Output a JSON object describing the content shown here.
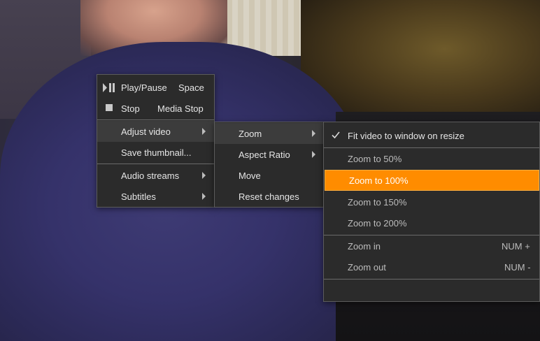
{
  "main_menu": {
    "items": [
      {
        "label": "Play/Pause",
        "shortcut": "Space",
        "icon": "play-pause-icon"
      },
      {
        "label": "Stop",
        "shortcut": "Media Stop",
        "icon": "stop-icon"
      },
      {
        "label": "Adjust video",
        "submenu": true
      },
      {
        "label": "Save thumbnail..."
      },
      {
        "label": "Audio streams",
        "submenu": true
      },
      {
        "label": "Subtitles",
        "submenu": true
      }
    ]
  },
  "adjust_menu": {
    "items": [
      {
        "label": "Zoom",
        "submenu": true
      },
      {
        "label": "Aspect Ratio",
        "submenu": true
      },
      {
        "label": "Move"
      },
      {
        "label": "Reset changes"
      }
    ]
  },
  "zoom_menu": {
    "fit_label": "Fit video to window on resize",
    "check_icon": "checkmark-icon",
    "items": [
      {
        "label": "Zoom to 50%"
      },
      {
        "label": "Zoom to 100%"
      },
      {
        "label": "Zoom to 150%"
      },
      {
        "label": "Zoom to 200%"
      }
    ],
    "zoom_in": {
      "label": "Zoom in",
      "shortcut": "NUM +"
    },
    "zoom_out": {
      "label": "Zoom out",
      "shortcut": "NUM -"
    }
  },
  "colors": {
    "menu_bg": "#2b2b2b",
    "highlight": "#3c3c3c",
    "selected": "#ff8c00"
  }
}
